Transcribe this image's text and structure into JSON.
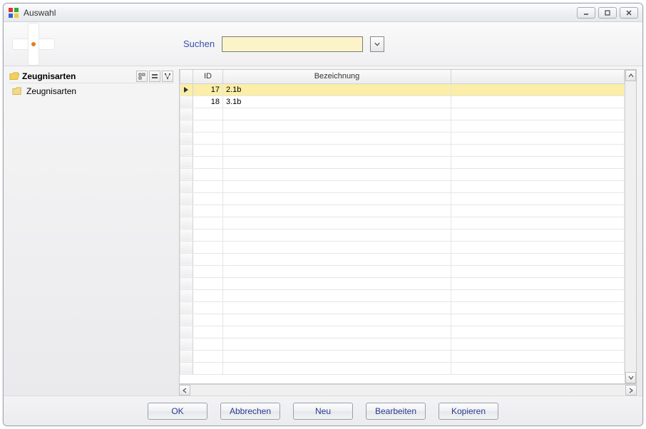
{
  "window": {
    "title": "Auswahl"
  },
  "toolbar": {
    "search_label": "Suchen",
    "search_value": "",
    "search_placeholder": ""
  },
  "tree": {
    "header_label": "Zeugnisarten",
    "items": [
      {
        "label": "Zeugnisarten"
      }
    ]
  },
  "grid": {
    "columns": {
      "id": "ID",
      "bezeichnung": "Bezeichnung"
    },
    "rows": [
      {
        "id": "17",
        "bezeichnung": "2.1b",
        "selected": true
      },
      {
        "id": "18",
        "bezeichnung": "3.1b",
        "selected": false
      }
    ]
  },
  "buttons": {
    "ok": "OK",
    "cancel": "Abbrechen",
    "new": "Neu",
    "edit": "Bearbeiten",
    "copy": "Kopieren"
  }
}
